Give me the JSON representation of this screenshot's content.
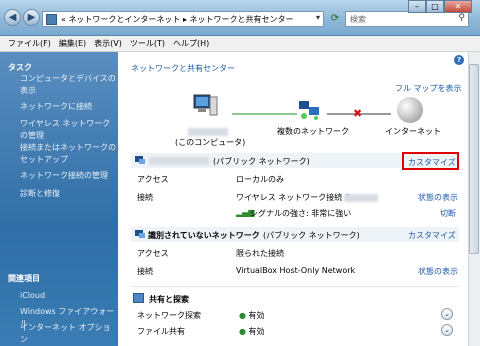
{
  "titlebar": {
    "back": "◀",
    "forward": "▶",
    "address_crumbs": "« ネットワークとインターネット ▸ ネットワークと共有センター",
    "search_placeholder": "検索"
  },
  "menu": [
    "ファイル(F)",
    "編集(E)",
    "表示(V)",
    "ツール(T)",
    "ヘルプ(H)"
  ],
  "sidebar": {
    "tasks_header": "タスク",
    "tasks": [
      "コンピュータとデバイスの表示",
      "ネットワークに接続",
      "ワイヤレス ネットワークの管理",
      "接続またはネットワークのセットアップ",
      "ネットワーク接続の管理",
      "診断と修復"
    ],
    "related_header": "関連項目",
    "related": [
      "iCloud",
      "Windows ファイアウォール",
      "インターネット オプション"
    ]
  },
  "main": {
    "page_title": "ネットワークと共有センター",
    "full_map_link": "フル マップを表示",
    "map": {
      "computer_label": "(このコンピュータ)",
      "multiple_networks_label": "複数のネットワーク",
      "internet_label": "インターネット"
    },
    "net1": {
      "type": "(パブリック ネットワーク)",
      "customize": "カスタマイズ",
      "rows": [
        {
          "label": "アクセス",
          "value": "ローカルのみ",
          "action": ""
        },
        {
          "label": "接続",
          "value": "ワイヤレス ネットワーク接続 6",
          "action": "状態の表示"
        }
      ],
      "signal": "シグナルの強さ: 非常に強い",
      "disconnect": "切断"
    },
    "net2": {
      "name": "識別されていないネットワーク",
      "type": "(パブリック ネットワーク)",
      "customize": "カスタマイズ",
      "rows": [
        {
          "label": "アクセス",
          "value": "限られた接続",
          "action": ""
        },
        {
          "label": "接続",
          "value": "VirtualBox Host-Only Network",
          "action": "状態の表示"
        }
      ]
    },
    "sharing": {
      "header": "共有と探索",
      "rows": [
        {
          "label": "ネットワーク探索",
          "value": "有効"
        },
        {
          "label": "ファイル共有",
          "value": "有効"
        }
      ]
    }
  },
  "help_icon": "?"
}
